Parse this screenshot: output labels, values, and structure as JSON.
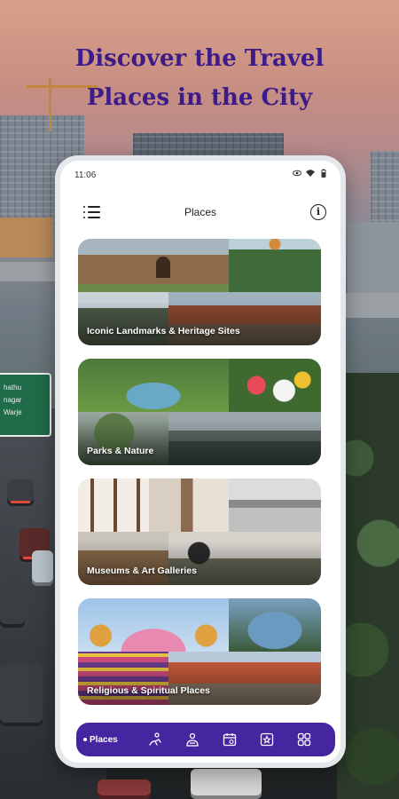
{
  "headline": {
    "line1": "Discover the Travel",
    "line2": "Places in the City"
  },
  "background": {
    "sign_lines": [
      "hathu",
      "nagar",
      "Warje"
    ]
  },
  "status_bar": {
    "time": "11:06"
  },
  "app_bar": {
    "title": "Places"
  },
  "categories": [
    {
      "label": "Iconic Landmarks & Heritage Sites"
    },
    {
      "label": "Parks & Nature"
    },
    {
      "label": "Museums & Art Galleries"
    },
    {
      "label": "Religious & Spiritual Places"
    }
  ],
  "bottom_nav": {
    "active_label": "Places",
    "items": [
      "hiking-icon",
      "guide-icon",
      "calendar-icon",
      "gallery-icon",
      "grid-icon"
    ]
  },
  "colors": {
    "accent": "#4526a0",
    "headline": "#3d1c8a"
  }
}
